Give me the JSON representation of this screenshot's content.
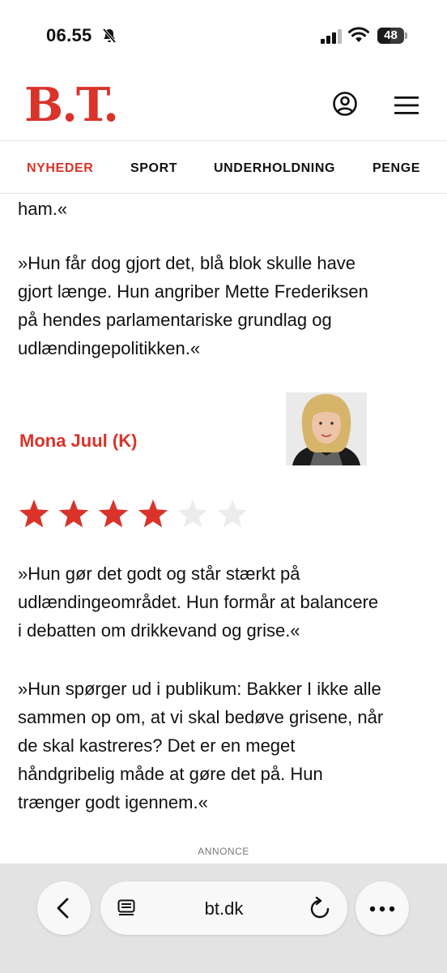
{
  "status_bar": {
    "time": "06.55",
    "battery": "48",
    "battery_level": 0.48
  },
  "header": {
    "logo": "B.T."
  },
  "nav": {
    "items": [
      "NYHEDER",
      "SPORT",
      "UNDERHOLDNING",
      "PENGE"
    ],
    "active": "NYHEDER"
  },
  "article": {
    "para_top": "ham.«",
    "para_1": [
      "»Hun får dog gjort det, blå blok skulle have",
      "gjort længe. Hun angriber Mette Frederiksen",
      "på hendes parlamentariske grundlag og",
      "udlændingepolitikken.«"
    ],
    "person": {
      "name": "Mona Juul (K)",
      "rating": 4,
      "max_rating": 6
    },
    "para_2": [
      "»Hun gør det godt og står stærkt på",
      "udlændingeområdet. Hun formår at balancere",
      "i debatten om drikkevand og grise.«"
    ],
    "para_3": [
      "»Hun spørger ud i publikum: Bakker I ikke alle",
      "sammen op om, at vi skal bedøve grisene, når",
      "de skal kastreres? Det er en meget",
      "håndgribelig måde at gøre det på. Hun",
      "trænger godt igennem.«"
    ]
  },
  "ad_label": "ANNONCE",
  "browser": {
    "url": "bt.dk"
  },
  "colors": {
    "brand": "#d9332a",
    "star_on": "#d9332a",
    "star_off": "#ececec"
  }
}
